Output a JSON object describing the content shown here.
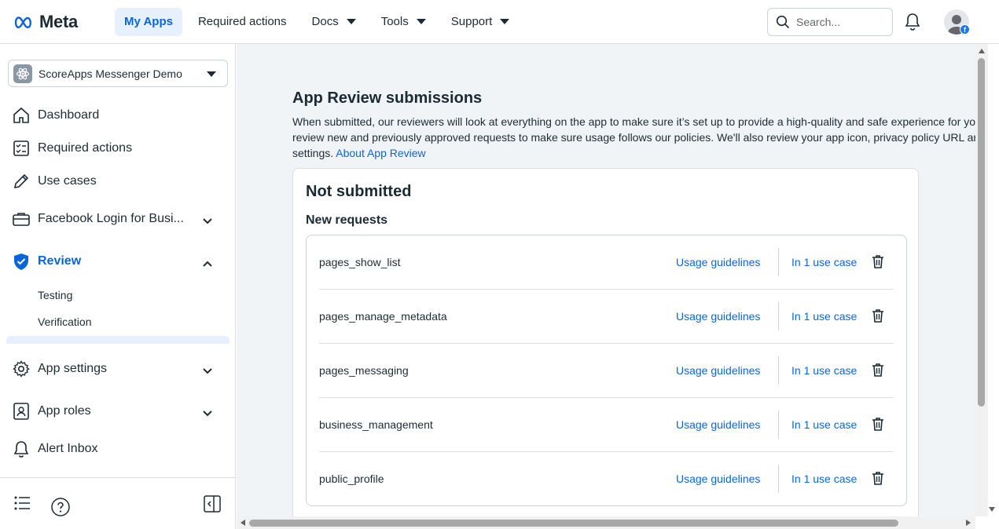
{
  "colors": {
    "accent": "#0a66d8",
    "link": "#0a66d8",
    "active_bg": "#e7f0fd",
    "main_bg": "#f1f4f7",
    "text": "#1c2b33"
  },
  "topnav": {
    "logo_text": "Meta",
    "items": [
      {
        "label": "My Apps",
        "active": true
      },
      {
        "label": "Required actions"
      },
      {
        "label": "Docs",
        "dropdown": true
      },
      {
        "label": "Tools",
        "dropdown": true
      },
      {
        "label": "Support",
        "dropdown": true
      }
    ],
    "search_placeholder": "Search..."
  },
  "sidebar": {
    "app_name": "ScoreApps Messenger Demo",
    "items": [
      {
        "label": "Dashboard",
        "icon": "home-icon"
      },
      {
        "label": "Required actions",
        "icon": "checklist-icon"
      },
      {
        "label": "Use cases",
        "icon": "pencil-icon"
      },
      {
        "label": "Facebook Login for Busi...",
        "icon": "briefcase-icon",
        "expandable": true
      },
      {
        "label": "Review",
        "icon": "shield-check-icon",
        "expanded": true,
        "active": true
      },
      {
        "label": "App settings",
        "icon": "gear-icon",
        "expandable": true
      },
      {
        "label": "App roles",
        "icon": "person-badge-icon",
        "expandable": true
      },
      {
        "label": "Alert Inbox",
        "icon": "bell-icon"
      }
    ],
    "review_subitems": [
      "Testing",
      "Verification"
    ]
  },
  "main": {
    "heading": "App Review submissions",
    "desc_line1": "When submitted, our reviewers will look at everything on the app to make sure it’s set up to provide a high-quality and safe experience for you",
    "desc_line2": "review new and previously approved requests to make sure usage follows our policies. We'll also review your app icon, privacy policy URL and",
    "desc_line3": "settings.",
    "desc_link": "About App Review",
    "card_title": "Not submitted",
    "card_subtitle": "New requests",
    "requests": [
      {
        "permission": "pages_show_list",
        "guidelines": "Usage guidelines",
        "use_case": "In 1 use case"
      },
      {
        "permission": "pages_manage_metadata",
        "guidelines": "Usage guidelines",
        "use_case": "In 1 use case"
      },
      {
        "permission": "pages_messaging",
        "guidelines": "Usage guidelines",
        "use_case": "In 1 use case"
      },
      {
        "permission": "business_management",
        "guidelines": "Usage guidelines",
        "use_case": "In 1 use case"
      },
      {
        "permission": "public_profile",
        "guidelines": "Usage guidelines",
        "use_case": "In 1 use case"
      }
    ]
  }
}
